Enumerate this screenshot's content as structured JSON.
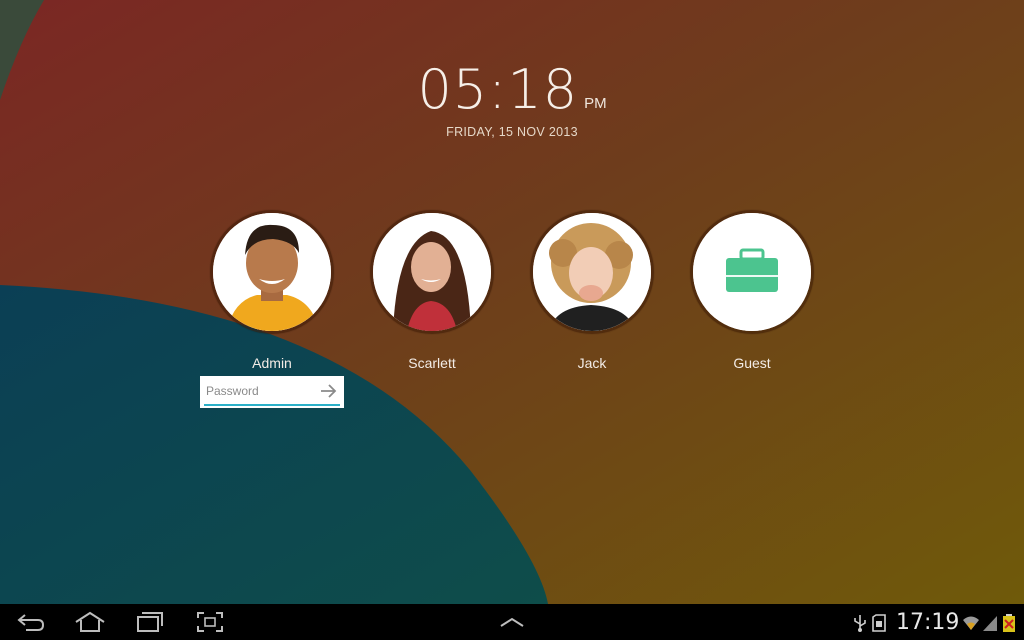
{
  "lockscreen": {
    "clock": {
      "time": "05:18",
      "ampm": "PM",
      "date": "FRIDAY, 15 NOV 2013"
    },
    "users": [
      {
        "name": "Admin",
        "avatar": "person-photo"
      },
      {
        "name": "Scarlett",
        "avatar": "person-photo"
      },
      {
        "name": "Jack",
        "avatar": "person-photo"
      },
      {
        "name": "Guest",
        "avatar": "briefcase-icon"
      }
    ],
    "password": {
      "placeholder": "Password",
      "value": ""
    }
  },
  "navbar": {
    "buttons": [
      "back-icon",
      "home-icon",
      "recent-apps-icon",
      "screenshot-icon",
      "chevron-up-icon"
    ],
    "status": {
      "time": "17:19",
      "icons": [
        "usb-icon",
        "sd-card-icon",
        "wifi-icon",
        "signal-icon",
        "battery-icon"
      ]
    }
  },
  "colors": {
    "wallpaper_red": "#7a2a26",
    "wallpaper_gold": "#7a5a10",
    "wallpaper_teal": "#0a4a56",
    "guest_briefcase": "#4cc48f",
    "password_underline": "#2bb0c8"
  }
}
